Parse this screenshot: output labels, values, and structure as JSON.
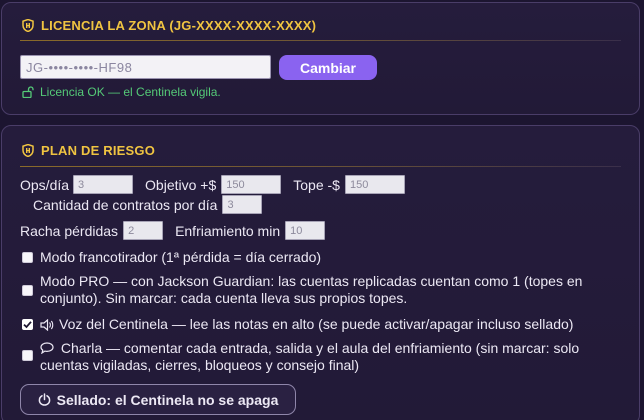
{
  "license": {
    "title": "LICENCIA LA ZONA (JG-XXXX-XXXX-XXXX)",
    "input_value": "JG-••••-••••-HF98",
    "change_button": "Cambiar",
    "status": "Licencia OK — el Centinela vigila."
  },
  "plan": {
    "title": "PLAN DE RIESGO",
    "ops_label": "Ops/día",
    "ops_value": "3",
    "target_label": "Objetivo +$",
    "target_value": "150",
    "cap_label": "Tope -$",
    "cap_value": "150",
    "contracts_label": "Cantidad de contratos por día",
    "contracts_value": "3",
    "loss_streak_label": "Racha pérdidas",
    "loss_streak_value": "2",
    "cooldown_label": "Enfriamiento min",
    "cooldown_value": "10",
    "sniper": {
      "checked": false,
      "label": "Modo francotirador (1ª pérdida = día cerrado)"
    },
    "pro": {
      "checked": false,
      "label": "Modo PRO — con Jackson Guardian: las cuentas replicadas cuentan como 1 (topes en conjunto). Sin marcar: cada cuenta lleva sus propios topes."
    },
    "voice": {
      "checked": true,
      "icon": "speaker-icon",
      "label": "Voz del Centinela — lee las notas en alto (se puede activar/apagar incluso sellado)"
    },
    "chat": {
      "checked": false,
      "icon": "speech-bubble-icon",
      "label": "Charla — comentar cada entrada, salida y el aula del enfriamiento (sin marcar: solo cuentas vigiladas, cierres, bloqueos y consejo final)"
    },
    "sealed_button": "Sellado: el Centinela no se apaga"
  },
  "colors": {
    "accent_gold": "#f0c441",
    "accent_purple": "#8a63f0",
    "ok_green": "#54c977",
    "background": "#1c1530"
  }
}
